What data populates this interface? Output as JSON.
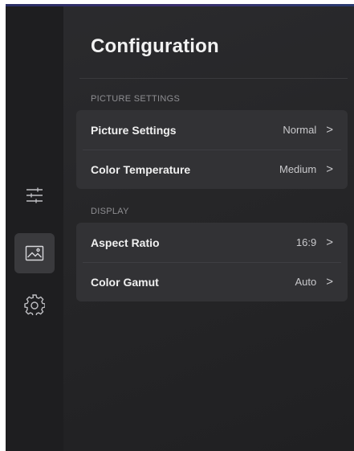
{
  "header": {
    "title": "Configuration"
  },
  "nav": {
    "items": [
      {
        "icon": "sliders-icon",
        "active": false
      },
      {
        "icon": "picture-icon",
        "active": true
      },
      {
        "icon": "gear-icon",
        "active": false
      }
    ]
  },
  "sections": [
    {
      "label": "PICTURE SETTINGS",
      "rows": [
        {
          "label": "Picture Settings",
          "value": "Normal",
          "chevron": ">"
        },
        {
          "label": "Color Temperature",
          "value": "Medium",
          "chevron": ">"
        }
      ]
    },
    {
      "label": "DISPLAY",
      "rows": [
        {
          "label": "Aspect Ratio",
          "value": "16:9",
          "chevron": ">"
        },
        {
          "label": "Color Gamut",
          "value": "Auto",
          "chevron": ">"
        }
      ]
    }
  ],
  "colors": {
    "background": "#262628",
    "rail": "#1e1e20",
    "card": "#323235",
    "active_nav": "#3a3a3d",
    "text_primary": "#f0f0f0",
    "text_secondary": "#8e8e92"
  }
}
